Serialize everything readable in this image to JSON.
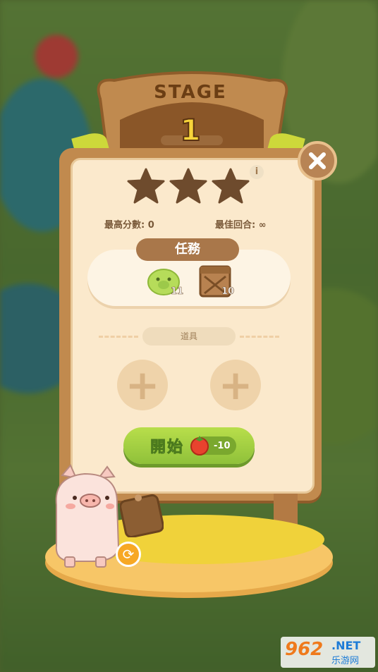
{
  "stage": {
    "label": "STAGE",
    "number": "1"
  },
  "stars": {
    "earned": 0,
    "total": 3
  },
  "stats": {
    "best_score_label": "最高分數: 0",
    "best_rounds_label": "最佳回合: ∞"
  },
  "tasks": {
    "title": "任務",
    "items": [
      {
        "icon": "green-pig-icon",
        "count": "11"
      },
      {
        "icon": "wooden-crate-icon",
        "count": "10"
      }
    ]
  },
  "items_section": {
    "label": "道具",
    "slots": 2
  },
  "start_button": {
    "label": "開始",
    "cost": "-10",
    "cost_icon": "tomato-icon"
  },
  "watermark": {
    "num": "962",
    "net": ".NET",
    "cn": "乐游网"
  },
  "colors": {
    "wood": "#c18a4e",
    "paper": "#fbe9cc",
    "start_green": "#9fcd3f",
    "stage_num": "#f7d43a"
  }
}
